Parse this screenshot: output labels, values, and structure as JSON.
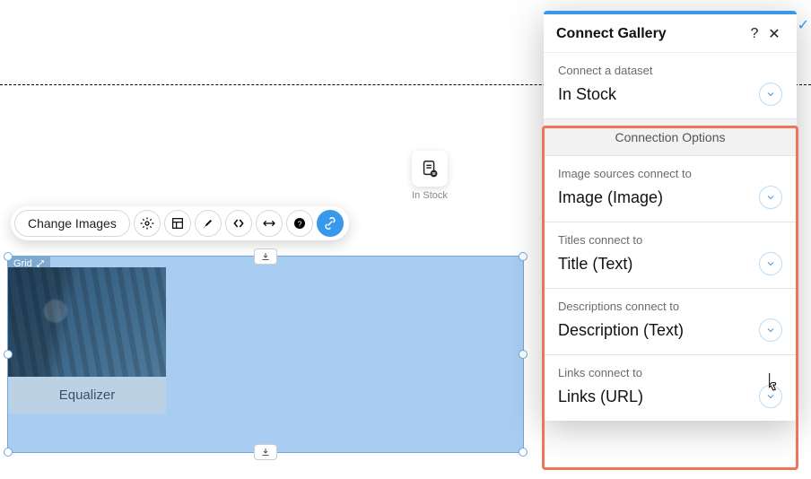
{
  "canvas": {
    "dataset_icon_label": "In Stock",
    "grid_tag": "Grid",
    "card_caption": "Equalizer"
  },
  "toolbar": {
    "change_images": "Change Images"
  },
  "panel": {
    "title": "Connect Gallery",
    "dataset_label": "Connect a dataset",
    "dataset_value": "In Stock",
    "options_header": "Connection Options",
    "rows": [
      {
        "label": "Image sources connect to",
        "value": "Image (Image)"
      },
      {
        "label": "Titles connect to",
        "value": "Title (Text)"
      },
      {
        "label": "Descriptions connect to",
        "value": "Description (Text)"
      },
      {
        "label": "Links connect to",
        "value": "Links (URL)"
      }
    ]
  }
}
